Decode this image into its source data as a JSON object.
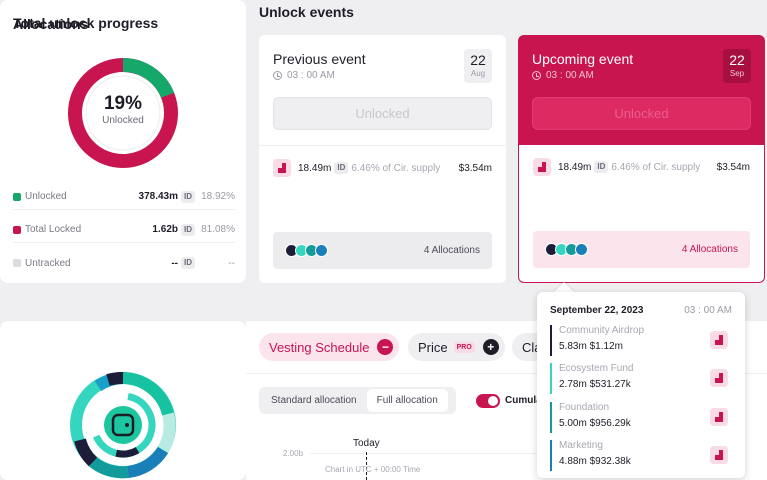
{
  "progress": {
    "title": "Total unlock progress",
    "percent": "19%",
    "percent_label": "Unlocked",
    "unlocked_fraction": 0.1892,
    "legend": [
      {
        "name": "Unlocked",
        "value": "378.43m",
        "tag": "ID",
        "pct": "18.92%",
        "color": "#16a86b"
      },
      {
        "name": "Total Locked",
        "value": "1.62b",
        "tag": "ID",
        "pct": "81.08%",
        "color": "#c8154f"
      },
      {
        "name": "Untracked",
        "value": "--",
        "tag": "ID",
        "pct": "--",
        "color": "#dcdce0"
      }
    ]
  },
  "events": {
    "title": "Unlock events",
    "previous": {
      "title": "Previous event",
      "time": "03 : 00 AM",
      "day": "22",
      "month": "Aug",
      "button": "Unlocked",
      "amount": "18.49m",
      "tag": "ID",
      "supply": "6.46% of Cir. supply",
      "usd": "$3.54m",
      "allocations": "4 Allocations"
    },
    "upcoming": {
      "title": "Upcoming event",
      "time": "03 : 00 AM",
      "day": "22",
      "month": "Sep",
      "button": "Unlocked",
      "amount": "18.49m",
      "tag": "ID",
      "supply": "6.46% of Cir. supply",
      "usd": "$3.54m",
      "allocations": "4 Allocations"
    }
  },
  "tooltip": {
    "date": "September 22, 2023",
    "time": "03 : 00 AM",
    "items": [
      {
        "name": "Community Airdrop",
        "amount": "5.83m",
        "usd": "$1.12m",
        "color": "#1d1d3a"
      },
      {
        "name": "Ecosystem Fund",
        "amount": "2.78m",
        "usd": "$531.27k",
        "color": "#35d6c0"
      },
      {
        "name": "Foundation",
        "amount": "5.00m",
        "usd": "$956.29k",
        "color": "#139a9a"
      },
      {
        "name": "Marketing",
        "amount": "4.88m",
        "usd": "$932.38k",
        "color": "#1a7fb8"
      }
    ]
  },
  "allocations": {
    "title": "Allocations"
  },
  "tabs": {
    "vesting": "Vesting Schedule",
    "price": "Price",
    "price_badge": "PRO",
    "third": "Cla"
  },
  "chart_controls": {
    "standard": "Standard allocation",
    "full": "Full allocation",
    "cumulative": "Cumula"
  },
  "chart": {
    "ytick": "2.00b",
    "today": "Today",
    "utc_note": "Chart in UTC + 00:00 Time"
  }
}
